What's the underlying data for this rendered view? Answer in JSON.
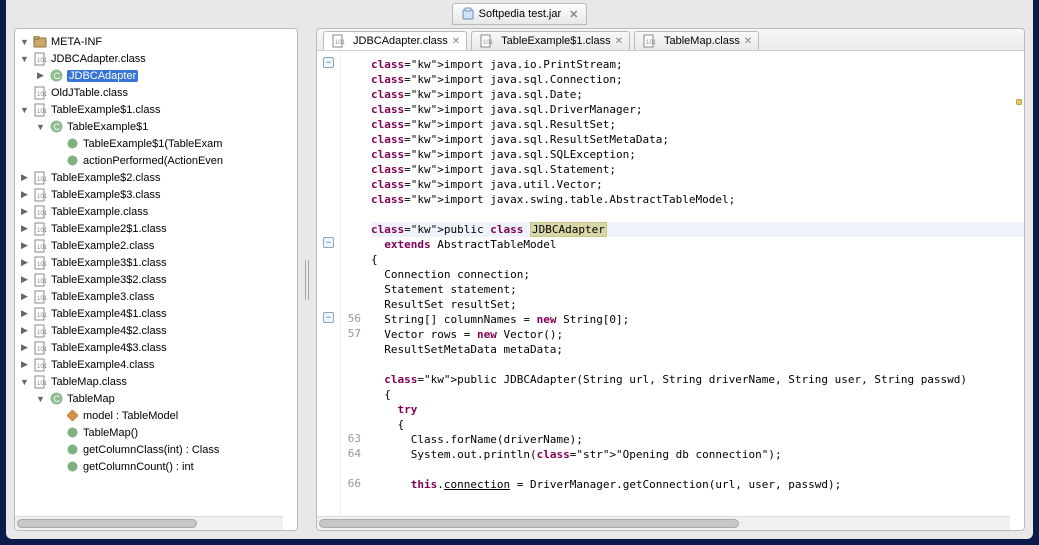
{
  "window": {
    "title": "Softpedia test.jar"
  },
  "tree": [
    {
      "depth": 0,
      "twisty": "expanded",
      "icon": "package",
      "label": "META-INF"
    },
    {
      "depth": 0,
      "twisty": "expanded",
      "icon": "classfile",
      "label": "JDBCAdapter.class"
    },
    {
      "depth": 1,
      "twisty": "collapsed",
      "icon": "class",
      "label": "JDBCAdapter",
      "selected": true
    },
    {
      "depth": 0,
      "twisty": "",
      "icon": "classfile",
      "label": "OldJTable.class"
    },
    {
      "depth": 0,
      "twisty": "expanded",
      "icon": "classfile",
      "label": "TableExample$1.class"
    },
    {
      "depth": 1,
      "twisty": "expanded",
      "icon": "class",
      "label": "TableExample$1"
    },
    {
      "depth": 2,
      "twisty": "",
      "icon": "method",
      "label": "TableExample$1(TableExam"
    },
    {
      "depth": 2,
      "twisty": "",
      "icon": "method",
      "label": "actionPerformed(ActionEven"
    },
    {
      "depth": 0,
      "twisty": "collapsed",
      "icon": "classfile",
      "label": "TableExample$2.class"
    },
    {
      "depth": 0,
      "twisty": "collapsed",
      "icon": "classfile",
      "label": "TableExample$3.class"
    },
    {
      "depth": 0,
      "twisty": "collapsed",
      "icon": "classfile",
      "label": "TableExample.class"
    },
    {
      "depth": 0,
      "twisty": "collapsed",
      "icon": "classfile",
      "label": "TableExample2$1.class"
    },
    {
      "depth": 0,
      "twisty": "collapsed",
      "icon": "classfile",
      "label": "TableExample2.class"
    },
    {
      "depth": 0,
      "twisty": "collapsed",
      "icon": "classfile",
      "label": "TableExample3$1.class"
    },
    {
      "depth": 0,
      "twisty": "collapsed",
      "icon": "classfile",
      "label": "TableExample3$2.class"
    },
    {
      "depth": 0,
      "twisty": "collapsed",
      "icon": "classfile",
      "label": "TableExample3.class"
    },
    {
      "depth": 0,
      "twisty": "collapsed",
      "icon": "classfile",
      "label": "TableExample4$1.class"
    },
    {
      "depth": 0,
      "twisty": "collapsed",
      "icon": "classfile",
      "label": "TableExample4$2.class"
    },
    {
      "depth": 0,
      "twisty": "collapsed",
      "icon": "classfile",
      "label": "TableExample4$3.class"
    },
    {
      "depth": 0,
      "twisty": "collapsed",
      "icon": "classfile",
      "label": "TableExample4.class"
    },
    {
      "depth": 0,
      "twisty": "expanded",
      "icon": "classfile",
      "label": "TableMap.class"
    },
    {
      "depth": 1,
      "twisty": "expanded",
      "icon": "class",
      "label": "TableMap"
    },
    {
      "depth": 2,
      "twisty": "",
      "icon": "field",
      "label": "model : TableModel"
    },
    {
      "depth": 2,
      "twisty": "",
      "icon": "method",
      "label": "TableMap()"
    },
    {
      "depth": 2,
      "twisty": "",
      "icon": "method",
      "label": "getColumnClass(int) : Class"
    },
    {
      "depth": 2,
      "twisty": "",
      "icon": "method",
      "label": "getColumnCount() : int"
    }
  ],
  "editor": {
    "tabs": [
      {
        "label": "JDBCAdapter.class",
        "active": true
      },
      {
        "label": "TableExample$1.class",
        "active": false
      },
      {
        "label": "TableMap.class",
        "active": false
      }
    ],
    "folds": [
      {
        "line": 0,
        "kind": "minus"
      },
      {
        "line": 12,
        "kind": "minus"
      },
      {
        "line": 17,
        "kind": "minus"
      }
    ],
    "lineNumbers": [
      {
        "line": 17,
        "n": "56"
      },
      {
        "line": 18,
        "n": "57"
      },
      {
        "line": 25,
        "n": "63"
      },
      {
        "line": 26,
        "n": "64"
      },
      {
        "line": 28,
        "n": "66"
      }
    ],
    "code": [
      "import java.io.PrintStream;",
      "import java.sql.Connection;",
      "import java.sql.Date;",
      "import java.sql.DriverManager;",
      "import java.sql.ResultSet;",
      "import java.sql.ResultSetMetaData;",
      "import java.sql.SQLException;",
      "import java.sql.Statement;",
      "import java.util.Vector;",
      "import javax.swing.table.AbstractTableModel;",
      "",
      "public class JDBCAdapter",
      "  extends AbstractTableModel",
      "{",
      "  Connection connection;",
      "  Statement statement;",
      "  ResultSet resultSet;",
      "  String[] columnNames = new String[0];",
      "  Vector rows = new Vector();",
      "  ResultSetMetaData metaData;",
      "  ",
      "  public JDBCAdapter(String url, String driverName, String user, String passwd)",
      "  {",
      "    try",
      "    {",
      "      Class.forName(driverName);",
      "      System.out.println(\"Opening db connection\");",
      "      ",
      "      this.connection = DriverManager.getConnection(url, user, passwd);"
    ]
  }
}
